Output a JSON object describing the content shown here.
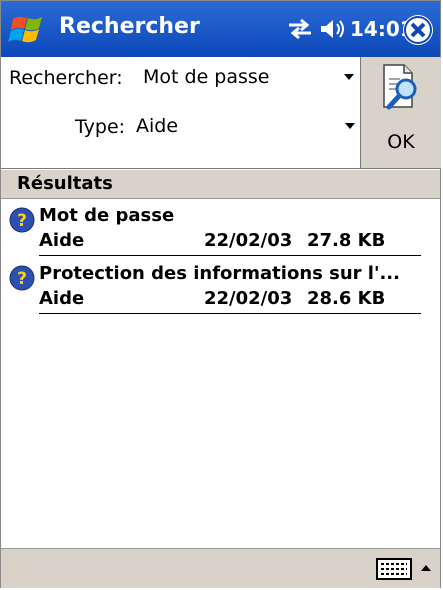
{
  "titlebar": {
    "app_title": "Rechercher",
    "clock": "14:01",
    "start_icon": "windows-flag-icon",
    "connectivity_icon": "connectivity-icon",
    "volume_icon": "speaker-icon",
    "close_icon": "close-icon"
  },
  "search": {
    "search_label": "Rechercher:",
    "search_value": "Mot de passe",
    "type_label": "Type:",
    "type_value": "Aide",
    "ok_label": "OK"
  },
  "results": {
    "header": "Résultats",
    "items": [
      {
        "title": "Mot de passe",
        "type": "Aide",
        "date": "22/02/03",
        "size": "27.8 KB"
      },
      {
        "title": "Protection des informations sur l'...",
        "type": "Aide",
        "date": "22/02/03",
        "size": "28.6 KB"
      }
    ]
  },
  "colors": {
    "titlebar": "#0d47b8",
    "panel": "#d8d2c8"
  }
}
